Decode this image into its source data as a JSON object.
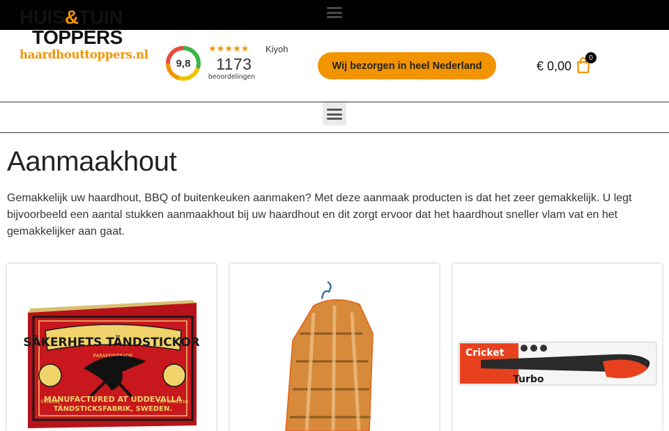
{
  "topbar": {
    "menu_icon": "hamburger-icon"
  },
  "logo": {
    "line1_a": "HUIS",
    "line1_amp": "&",
    "line1_b": "TUIN",
    "line2": "TOPPERS",
    "line3": "haardhouttoppers.nl"
  },
  "rating": {
    "score": "9,8",
    "stars": "★★★★★",
    "provider": "Kiyoh",
    "count": "1173",
    "count_label": "beoordelingen"
  },
  "delivery_button": {
    "label": "Wij bezorgen in heel Nederland"
  },
  "cart": {
    "total": "€ 0,00",
    "count": "0",
    "icon": "shopping-bag-icon"
  },
  "nav": {
    "toggle_icon": "hamburger-icon"
  },
  "page": {
    "title": "Aanmaakhout",
    "intro": "Gemakkelijk uw haardhout, BBQ of buitenkeuken aanmaken? Met deze aanmaak producten is dat het zeer gemakkelijk. U legt bijvoorbeeld een aantal stukken aanmaakhout bij uw haardhout en dit zorgt ervoor dat het haardhout sneller vlam vat en het gemakkelijker aan gaat."
  },
  "products": [
    {
      "image": "matchbox-product-image",
      "box_title": "SÄKERHETS TÄNDSTICKOR",
      "box_top": "PARAFFINERADE",
      "box_left": "SVALAN",
      "box_right": "THE SWALLOW",
      "box_bottom1": "MANUFACTURED AT UDDEVALLA",
      "box_bottom2": "TÄNDSTICKSFABRIK, SWEDEN."
    },
    {
      "image": "kindling-wood-bag-image"
    },
    {
      "image": "cricket-turbo-lighter-image",
      "brand": "Cricket",
      "model": "Turbo"
    }
  ],
  "colors": {
    "accent": "#f29400",
    "topbar": "#000000"
  }
}
